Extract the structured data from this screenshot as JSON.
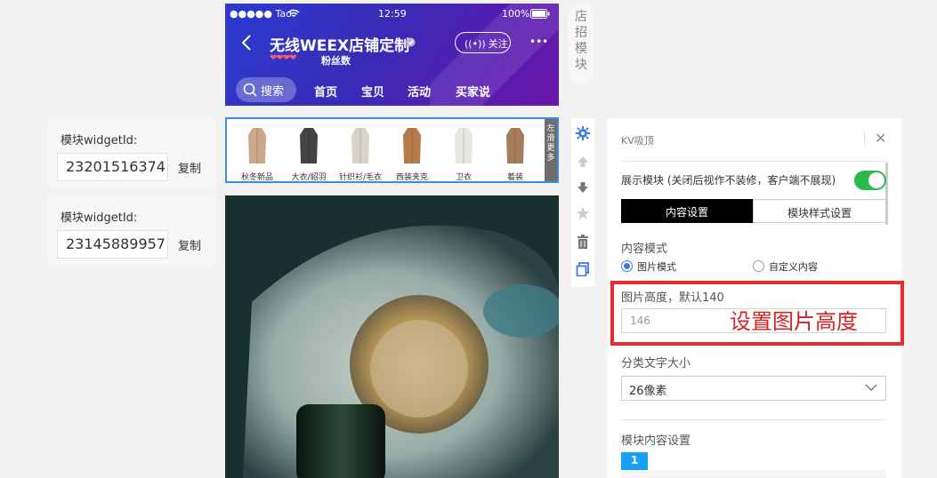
{
  "widgets": [
    {
      "label": "模块widgetId:",
      "id": "23201516374",
      "copy": "复制"
    },
    {
      "label": "模块widgetId:",
      "id": "23145889957",
      "copy": "复制"
    }
  ],
  "status_bar": {
    "carrier": "●●●●● Tao",
    "time": "12:59",
    "battery": "100%"
  },
  "shop": {
    "title": "无线WEEX店铺定制",
    "hearts": "❤❤❤❤",
    "fans": "粉丝数",
    "follow": "关注",
    "more": "•••"
  },
  "nav": {
    "search": "搜索",
    "items": [
      "首页",
      "宝贝",
      "活动",
      "买家说"
    ]
  },
  "side_tag": "店招模块",
  "categories": [
    {
      "label": "秋冬新品",
      "color": "#c9a98a"
    },
    {
      "label": "大衣/貂羽",
      "color": "#444444"
    },
    {
      "label": "针织衫/毛衣",
      "color": "#d9d2c6"
    },
    {
      "label": "西装夹克",
      "color": "#b77a4a"
    },
    {
      "label": "卫衣",
      "color": "#e8e6e0"
    },
    {
      "label": "着装",
      "color": "#a67d5a"
    }
  ],
  "swipe_more": "左滑更多",
  "panel": {
    "title": "KV吸顶",
    "close": "✕",
    "show_label": "展示模块 (关闭后视作不装修，客户端不展现)",
    "toggle_on": true,
    "tabs": [
      "内容设置",
      "模块样式设置"
    ],
    "content_mode_label": "内容模式",
    "modes": [
      "图片模式",
      "自定义内容"
    ],
    "image_height_label": "图片高度，默认140",
    "image_height_value": "146",
    "font_size_label": "分类文字大小",
    "font_size_value": "26像素",
    "module_content_label": "模块内容设置",
    "badge": "1"
  },
  "annotation": "设置图片高度",
  "colors": {
    "accent": "#3a7be8",
    "toggle": "#2db84d",
    "annotation": "#e52d2d",
    "badge": "#1aa0f2"
  }
}
